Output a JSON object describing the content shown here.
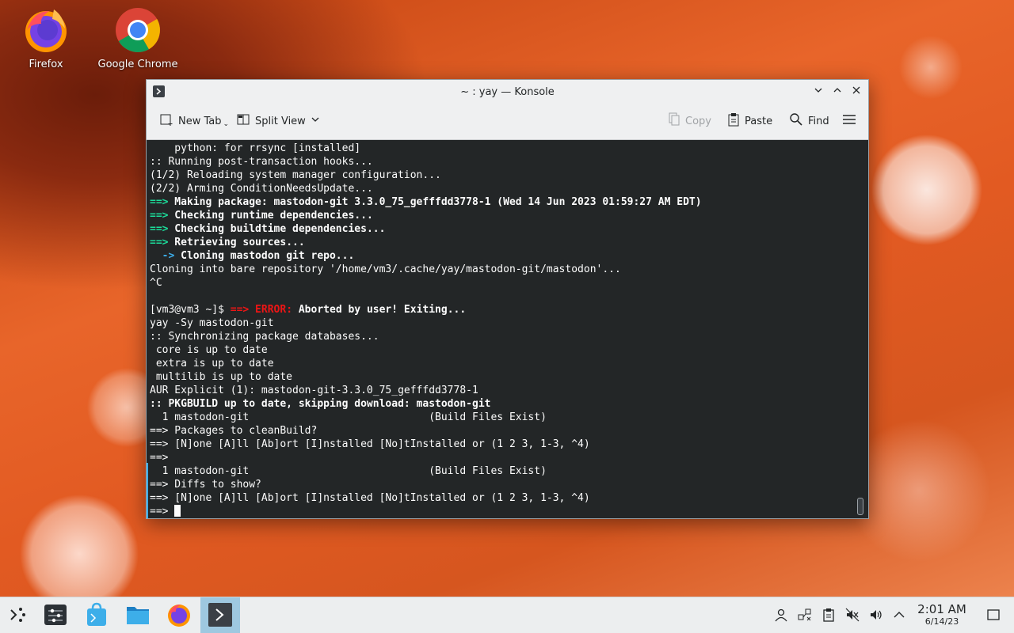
{
  "desktop": {
    "icons": [
      {
        "label": "Firefox",
        "icon": "firefox-icon"
      },
      {
        "label": "Google Chrome",
        "icon": "chrome-icon"
      }
    ]
  },
  "window": {
    "title": "~ : yay — Konsole",
    "toolbar": {
      "new_tab": "New Tab",
      "split_view": "Split View",
      "copy": "Copy",
      "paste": "Paste",
      "find": "Find"
    }
  },
  "terminal": {
    "lines": [
      {
        "parts": [
          {
            "t": "    python: for rrsync [installed]",
            "c": ""
          }
        ]
      },
      {
        "parts": [
          {
            "t": ":: Running post-transaction hooks...",
            "c": ""
          }
        ]
      },
      {
        "parts": [
          {
            "t": "(1/2) Reloading system manager configuration...",
            "c": ""
          }
        ]
      },
      {
        "parts": [
          {
            "t": "(2/2) Arming ConditionNeedsUpdate...",
            "c": ""
          }
        ]
      },
      {
        "parts": [
          {
            "t": "==>",
            "c": "g"
          },
          {
            "t": " Making package: mastodon-git 3.3.0_75_gefffdd3778-1 (Wed 14 Jun 2023 01:59:27 AM EDT)",
            "c": "b"
          }
        ]
      },
      {
        "parts": [
          {
            "t": "==>",
            "c": "g"
          },
          {
            "t": " Checking runtime dependencies...",
            "c": "b"
          }
        ]
      },
      {
        "parts": [
          {
            "t": "==>",
            "c": "g"
          },
          {
            "t": " Checking buildtime dependencies...",
            "c": "b"
          }
        ]
      },
      {
        "parts": [
          {
            "t": "==>",
            "c": "g"
          },
          {
            "t": " Retrieving sources...",
            "c": "b"
          }
        ]
      },
      {
        "parts": [
          {
            "t": "  ->",
            "c": "cy"
          },
          {
            "t": " Cloning mastodon git repo...",
            "c": "b"
          }
        ]
      },
      {
        "parts": [
          {
            "t": "Cloning into bare repository '/home/vm3/.cache/yay/mastodon-git/mastodon'...",
            "c": ""
          }
        ]
      },
      {
        "parts": [
          {
            "t": "^C",
            "c": ""
          }
        ]
      },
      {
        "parts": [
          {
            "t": "",
            "c": ""
          }
        ]
      },
      {
        "parts": [
          {
            "t": "[vm3@vm3 ~]$ ",
            "c": ""
          },
          {
            "t": "==> ERROR:",
            "c": "r"
          },
          {
            "t": " Aborted by user! Exiting...",
            "c": "b"
          }
        ]
      },
      {
        "parts": [
          {
            "t": "yay -Sy mastodon-git",
            "c": ""
          }
        ]
      },
      {
        "parts": [
          {
            "t": ":: Synchronizing package databases...",
            "c": ""
          }
        ]
      },
      {
        "parts": [
          {
            "t": " core is up to date",
            "c": ""
          }
        ]
      },
      {
        "parts": [
          {
            "t": " extra is up to date",
            "c": ""
          }
        ]
      },
      {
        "parts": [
          {
            "t": " multilib is up to date",
            "c": ""
          }
        ]
      },
      {
        "parts": [
          {
            "t": "AUR Explicit (1): mastodon-git-3.3.0_75_gefffdd3778-1",
            "c": ""
          }
        ]
      },
      {
        "parts": [
          {
            "t": ":: PKGBUILD up to date, skipping download: mastodon-git",
            "c": "b"
          }
        ]
      },
      {
        "parts": [
          {
            "t": "  1 mastodon-git                             (Build Files Exist)",
            "c": ""
          }
        ]
      },
      {
        "parts": [
          {
            "t": "==> Packages to cleanBuild?",
            "c": ""
          }
        ]
      },
      {
        "parts": [
          {
            "t": "==> [N]one [A]ll [Ab]ort [I]nstalled [No]tInstalled or (1 2 3, 1-3, ^4)",
            "c": ""
          }
        ]
      },
      {
        "parts": [
          {
            "t": "==>",
            "c": ""
          }
        ]
      },
      {
        "parts": [
          {
            "t": "  1 mastodon-git                             (Build Files Exist)",
            "c": ""
          }
        ]
      },
      {
        "parts": [
          {
            "t": "==> Diffs to show?",
            "c": ""
          }
        ]
      },
      {
        "parts": [
          {
            "t": "==> [N]one [A]ll [Ab]ort [I]nstalled [No]tInstalled or (1 2 3, 1-3, ^4)",
            "c": ""
          }
        ]
      },
      {
        "parts": [
          {
            "t": "==> ",
            "c": ""
          }
        ],
        "cursor": true
      }
    ]
  },
  "taskbar": {
    "launchers": [
      "app-launcher-icon",
      "system-settings-icon",
      "discover-icon",
      "dolphin-icon",
      "firefox-icon",
      "konsole-icon"
    ],
    "tray": [
      "user-icon",
      "network-icon",
      "clipboard-icon",
      "volume-muted-icon",
      "volume-icon",
      "chevron-up-icon"
    ],
    "time": "2:01 AM",
    "date": "6/14/23"
  },
  "colors": {
    "accent": "#3daee9",
    "green": "#1cdc9a",
    "error": "#ed1515"
  }
}
